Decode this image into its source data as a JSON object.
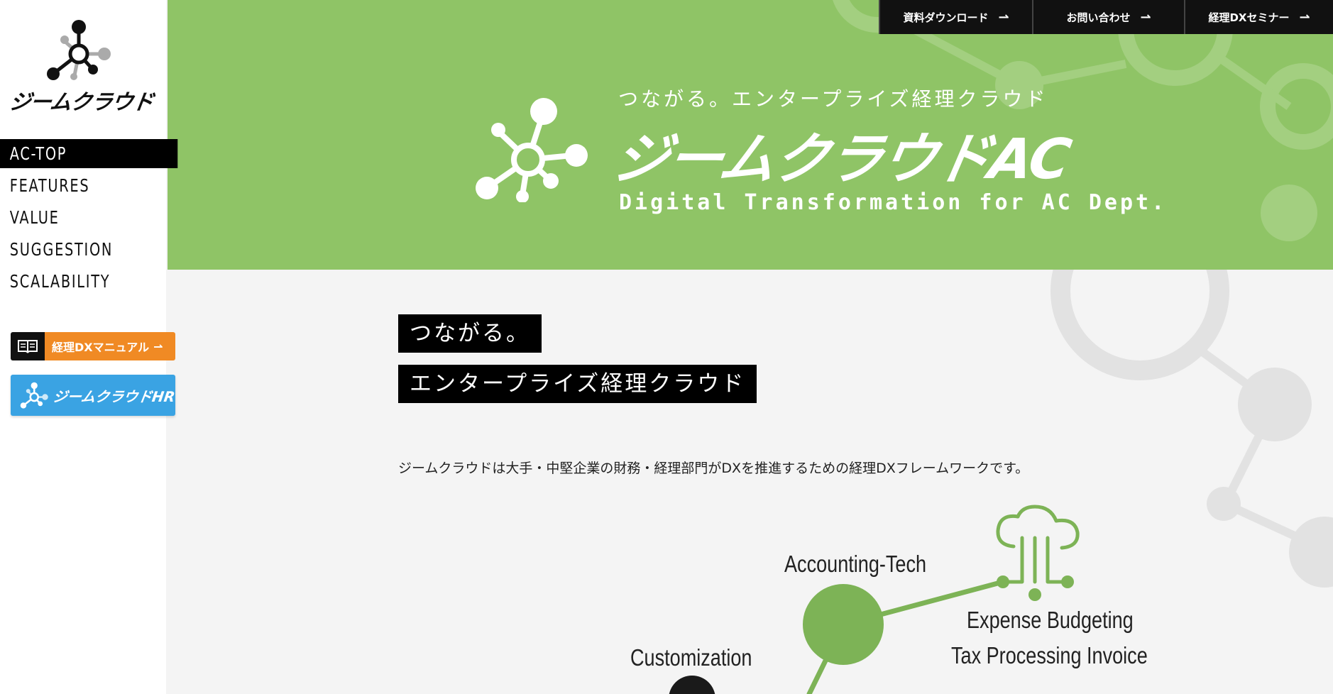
{
  "sidebar": {
    "logo_text": "ジームクラウド",
    "nav": [
      {
        "label": "AC-TOP",
        "active": true
      },
      {
        "label": "FEATURES",
        "active": false
      },
      {
        "label": "VALUE",
        "active": false
      },
      {
        "label": "SUGGESTION",
        "active": false
      },
      {
        "label": "SCALABILITY",
        "active": false
      }
    ],
    "manual_button": {
      "label": "経理DXマニュアル",
      "icon": "book-icon",
      "color": "#f08a24"
    },
    "hr_banner": {
      "label": "ジームクラウドHR",
      "color": "#3aa3e3"
    }
  },
  "header": {
    "links": [
      {
        "label": "資料ダウンロード"
      },
      {
        "label": "お問い合わせ"
      },
      {
        "label": "経理DXセミナー"
      }
    ]
  },
  "hero": {
    "tagline": "つながる。エンタープライズ経理クラウド",
    "title": "ジームクラウドAC",
    "subtitle": "Digital Transformation for AC Dept.",
    "bg_color": "#8fc466"
  },
  "main": {
    "heading_line1": "つながる。",
    "heading_line2": "エンタープライズ経理クラウド",
    "description": "ジームクラウドは大手・中堅企業の財務・経理部門がDXを推進するための経理DXフレームワークです。",
    "diagram": {
      "node_accounting": "Accounting-Tech",
      "node_customization": "Customization",
      "cloud_line1": "Expense Budgeting",
      "cloud_line2": "Tax Processing Invoice"
    }
  }
}
